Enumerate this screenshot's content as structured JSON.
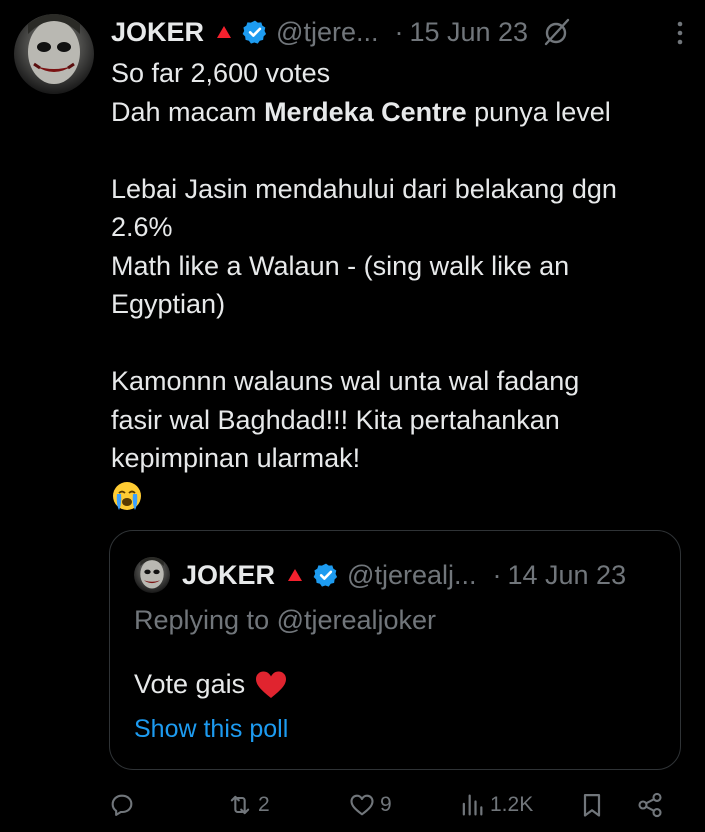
{
  "tweet": {
    "author_name": "JOKER",
    "handle": "@tjere...",
    "separator": "·",
    "date": "15 Jun 23",
    "lines": {
      "l1": "So far 2,600 votes",
      "l2_pre": "Dah macam ",
      "l2_bold": "Merdeka Centre",
      "l2_post": " punya level",
      "l3": "Lebai Jasin mendahului dari belakang dgn",
      "l4": "2.6%",
      "l5": "Math like a Walaun - (sing walk like an",
      "l6": "Egyptian)",
      "l7": "Kamonnn walauns wal unta wal fadang",
      "l8": "fasir wal Baghdad!!! Kita pertahankan",
      "l9": "kepimpinan ularmak!"
    }
  },
  "quoted": {
    "author_name": "JOKER",
    "handle": "@tjerealj...",
    "separator": "·",
    "date": "14 Jun 23",
    "replying_to": "Replying to @tjerealjoker",
    "text": "Vote gais",
    "show_poll": "Show this poll"
  },
  "actions": {
    "reply_count": "",
    "retweet_count": "2",
    "like_count": "9",
    "views_count": "1.2K"
  },
  "colors": {
    "background": "#000000",
    "text": "#e7e9ea",
    "muted": "#71767b",
    "link": "#1d9bf0",
    "verified": "#1d9bf0",
    "red_triangle": "#f4212e"
  }
}
